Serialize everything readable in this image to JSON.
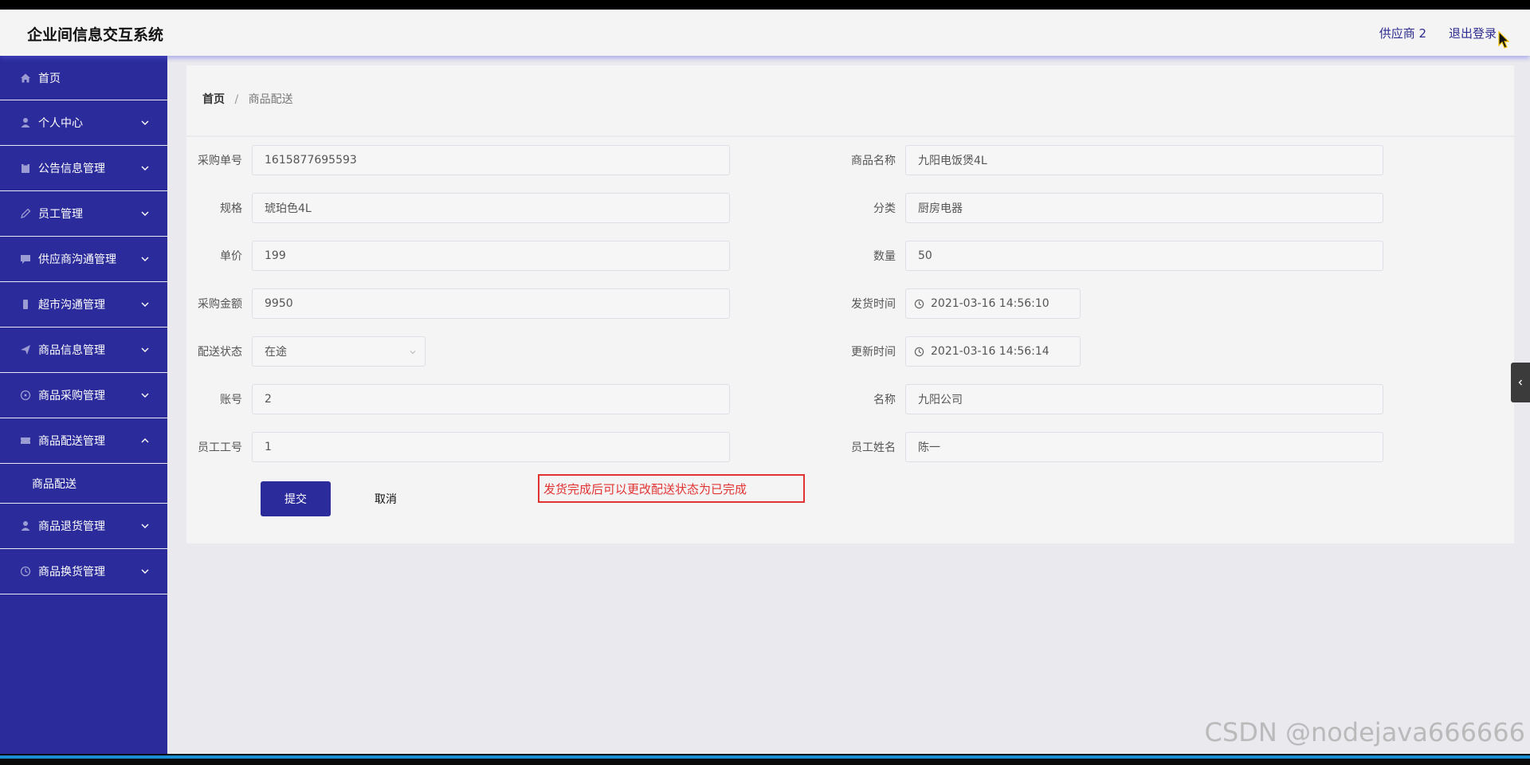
{
  "header": {
    "title": "企业间信息交互系统",
    "user": "供应商 2",
    "logout": "退出登录"
  },
  "sidebar": {
    "items": [
      {
        "label": "首页",
        "icon": "home-icon"
      },
      {
        "label": "个人中心",
        "icon": "user-icon"
      },
      {
        "label": "公告信息管理",
        "icon": "clipboard-icon"
      },
      {
        "label": "员工管理",
        "icon": "pen-icon"
      },
      {
        "label": "供应商沟通管理",
        "icon": "chat-icon"
      },
      {
        "label": "超市沟通管理",
        "icon": "phone-icon"
      },
      {
        "label": "商品信息管理",
        "icon": "send-icon"
      },
      {
        "label": "商品采购管理",
        "icon": "compass-icon"
      },
      {
        "label": "商品配送管理",
        "icon": "ticket-icon"
      },
      {
        "label": "商品退货管理",
        "icon": "user-icon"
      },
      {
        "label": "商品换货管理",
        "icon": "clock-icon"
      }
    ],
    "sub_item": "商品配送"
  },
  "breadcrumb": {
    "home": "首页",
    "separator": "/",
    "current": "商品配送"
  },
  "form": {
    "purchase_no": {
      "label": "采购单号",
      "value": "1615877695593"
    },
    "product_name": {
      "label": "商品名称",
      "value": "九阳电饭煲4L"
    },
    "spec": {
      "label": "规格",
      "value": "琥珀色4L"
    },
    "category": {
      "label": "分类",
      "value": "厨房电器"
    },
    "unit_price": {
      "label": "单价",
      "value": "199"
    },
    "quantity": {
      "label": "数量",
      "value": "50"
    },
    "amount": {
      "label": "采购金额",
      "value": "9950"
    },
    "ship_time": {
      "label": "发货时间",
      "value": "2021-03-16 14:56:10"
    },
    "status": {
      "label": "配送状态",
      "value": "在途"
    },
    "update_time": {
      "label": "更新时间",
      "value": "2021-03-16 14:56:14"
    },
    "account": {
      "label": "账号",
      "value": "2"
    },
    "name": {
      "label": "名称",
      "value": "九阳公司"
    },
    "emp_no": {
      "label": "员工工号",
      "value": "1"
    },
    "emp_name": {
      "label": "员工姓名",
      "value": "陈一"
    },
    "submit": "提交",
    "cancel": "取消",
    "note": "发货完成后可以更改配送状态为已完成"
  },
  "watermark": "CSDN @nodejava666666",
  "colors": {
    "sidebar": "#2b2b9b",
    "accent": "#2d2b8f",
    "note": "#e23333"
  }
}
